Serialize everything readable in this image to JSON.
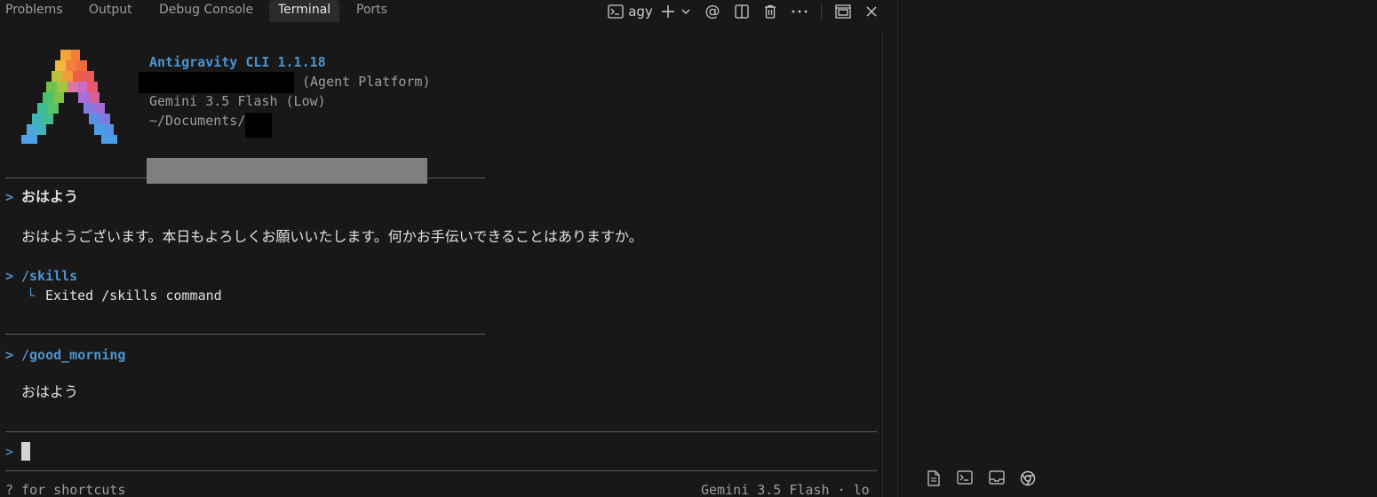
{
  "tabs": [
    {
      "label": "Problems"
    },
    {
      "label": "Output"
    },
    {
      "label": "Debug Console"
    },
    {
      "label": "Terminal",
      "active": true
    },
    {
      "label": "Ports"
    }
  ],
  "toolbar": {
    "terminal_name": "agy",
    "icons": [
      "terminal-icon",
      "plus-icon",
      "chevron-down-icon",
      "at-icon",
      "split-icon",
      "trash-icon",
      "ellipsis-icon",
      "maximize-icon",
      "close-icon"
    ]
  },
  "header": {
    "title": "Antigravity CLI 1.1.18",
    "platform": "(Agent Platform)",
    "model": "Gemini 3.5 Flash (Low)",
    "path": "~/Documents/"
  },
  "conversation": {
    "prompt_symbol": ">",
    "entries": [
      {
        "input": "おはよう",
        "output": "おはようございます。本日もよろしくお願いいたします。何かお手伝いできることはありますか。"
      },
      {
        "input": "/skills",
        "tree_symbol": "└",
        "output": "Exited /skills command"
      },
      {
        "input": "/good_morning",
        "output": "おはよう"
      }
    ]
  },
  "footer": {
    "hint": "? for shortcuts",
    "status": "Gemini 3.5 Flash · lo"
  },
  "right_panel": {
    "icons": [
      "file-icon",
      "terminal-icon",
      "inbox-icon",
      "chrome-icon"
    ]
  },
  "colors": {
    "background": "#181818",
    "accent_blue": "#4e94ce",
    "text": "#cccccc"
  }
}
